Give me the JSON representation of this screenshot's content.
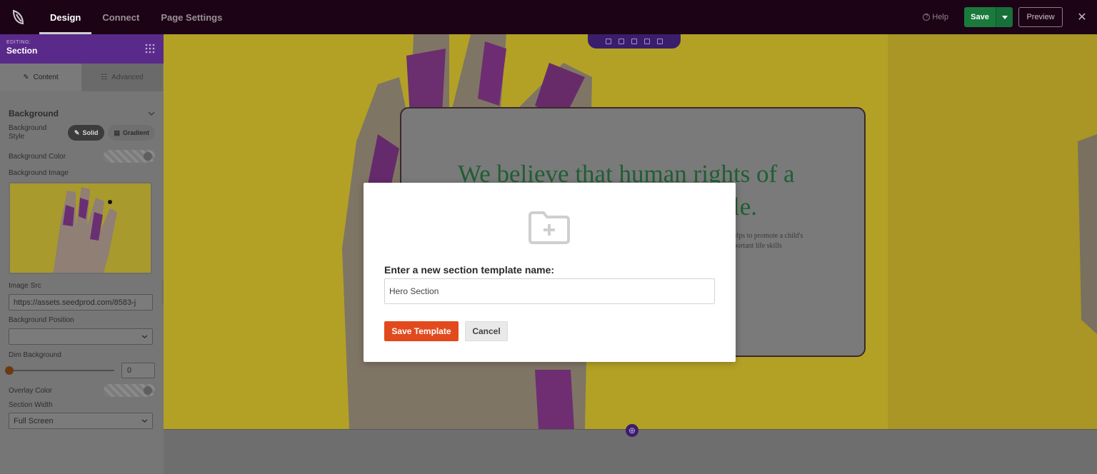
{
  "topbar": {
    "tabs": [
      {
        "label": "Design",
        "active": true
      },
      {
        "label": "Connect",
        "active": false
      },
      {
        "label": "Page Settings",
        "active": false
      }
    ],
    "help_label": "Help",
    "save_label": "Save",
    "preview_label": "Preview",
    "close_icon": "close-icon",
    "colors": {
      "bar": "#1c0416",
      "save": "#1a7a3c"
    }
  },
  "sidebar": {
    "editing_label": "EDITING:",
    "editing_title": "Section",
    "tabs": [
      {
        "label": "Content",
        "icon": "pencil-icon"
      },
      {
        "label": "Advanced",
        "icon": "sliders-icon"
      }
    ],
    "section_title": "Background",
    "bg_style_label": "Background Style",
    "bg_style_options": [
      {
        "label": "Solid",
        "selected": true
      },
      {
        "label": "Gradient",
        "selected": false
      }
    ],
    "bg_color_label": "Background Color",
    "bg_image_label": "Background Image",
    "image_src_label": "Image Src",
    "image_src_value": "https://assets.seedprod.com/8583-j",
    "bg_position_label": "Background Position",
    "bg_position_value": "",
    "dim_label": "Dim Background",
    "dim_value": "0",
    "overlay_label": "Overlay Color",
    "width_label": "Section Width",
    "width_value": "Full Screen"
  },
  "canvas": {
    "headline_line1": "We believe that human rights of a",
    "headline_line2": "le.",
    "subtext_line1": "elps to promote a child's",
    "subtext_line2": "portant life skills"
  },
  "modal": {
    "icon": "folder-plus-icon",
    "label": "Enter a new section template name:",
    "input_value": "Hero Section",
    "save_label": "Save Template",
    "cancel_label": "Cancel",
    "accent": "#e24a1d"
  }
}
